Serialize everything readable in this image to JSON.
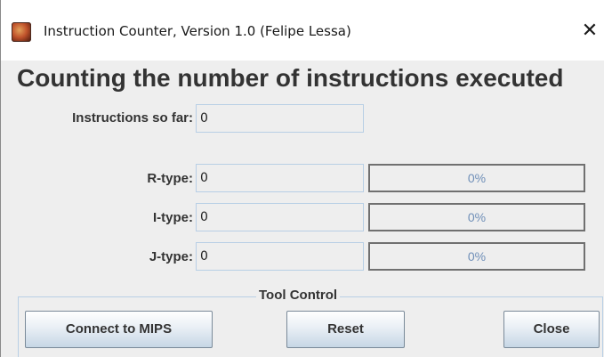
{
  "window": {
    "title": "Instruction Counter, Version 1.0 (Felipe Lessa)",
    "close_glyph": "✕",
    "app_icon": "mars-planet-icon"
  },
  "heading": "Counting the number of instructions executed",
  "instructions": {
    "label": "Instructions so far:",
    "value": "0"
  },
  "types": [
    {
      "label": "R-type:",
      "value": "0",
      "percent_text": "0%",
      "fraction": 0
    },
    {
      "label": "I-type:",
      "value": "0",
      "percent_text": "0%",
      "fraction": 0
    },
    {
      "label": "J-type:",
      "value": "0",
      "percent_text": "0%",
      "fraction": 0
    }
  ],
  "tool_control": {
    "title": "Tool Control",
    "connect_label": "Connect to MIPS",
    "reset_label": "Reset",
    "close_label": "Close"
  },
  "colors": {
    "field_border": "#b8cfe5",
    "bar_text": "#6f8fb8",
    "bar_border": "#707070"
  }
}
